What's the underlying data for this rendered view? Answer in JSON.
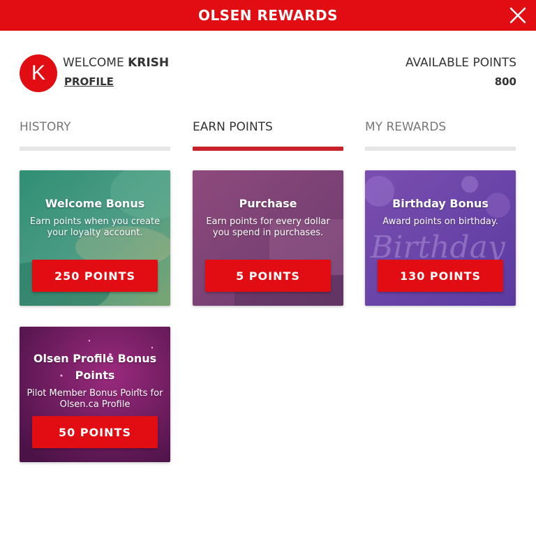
{
  "header": {
    "title": "OLSEN REWARDS"
  },
  "user": {
    "initial": "K",
    "welcome_prefix": "WELCOME",
    "name": "KRISH",
    "profile_link": "PROFILE"
  },
  "points": {
    "label": "AVAILABLE POINTS",
    "value": "800"
  },
  "tabs": [
    {
      "label": "HISTORY",
      "active": false
    },
    {
      "label": "EARN POINTS",
      "active": true
    },
    {
      "label": "MY REWARDS",
      "active": false
    }
  ],
  "cards": [
    {
      "title": "Welcome Bonus",
      "description": "Earn points when you create your loyalty account.",
      "button": "250 POINTS"
    },
    {
      "title": "Purchase",
      "description": "Earn points for every dollar you spend in purchases.",
      "button": "5 POINTS"
    },
    {
      "title": "Birthday Bonus",
      "description": "Award points on birthday.",
      "button": "130 POINTS",
      "background_text": "Birthday"
    },
    {
      "title": "Olsen Profile Bonus Points",
      "description": "Pilot Member Bonus Points for Olsen.ca Profile",
      "button": "50 POINTS"
    }
  ],
  "colors": {
    "brand_red": "#e10d13",
    "active_tab": "#c8232a",
    "inactive_bar": "#e6e6e6"
  }
}
